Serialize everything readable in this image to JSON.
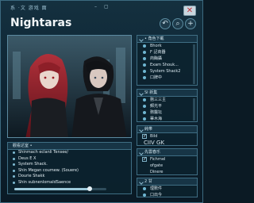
{
  "window": {
    "title_text": "系 ·文  游戏  面",
    "minimize_glyph": "–",
    "restore_glyph": "▢",
    "close_glyph": "✕"
  },
  "app": {
    "title": "Nightaras",
    "buttons": [
      {
        "icon": "back-arrow-icon",
        "glyph": "↶"
      },
      {
        "icon": "search-icon",
        "glyph": "⌕"
      },
      {
        "icon": "plus-icon",
        "glyph": "+"
      }
    ]
  },
  "panels": {
    "characters": {
      "header": "• 角色下載",
      "items": [
        "Bhork",
        "F 記商器",
        "商酶攝",
        "Exam Shouk...",
        "System Shack2",
        "口牌中"
      ]
    },
    "info": {
      "header": "SI 新集",
      "items": [
        "務三三主",
        "郵光平",
        "務醫坛",
        "畢木海"
      ]
    },
    "options": {
      "header": "純帯",
      "items": [
        {
          "label": "Bild",
          "checked": true
        },
        {
          "label": "CIIV GK",
          "checked": false
        }
      ]
    },
    "music": {
      "header": "先雲春乐",
      "items": [
        "Fichrnel",
        "ofgate",
        "Dinere"
      ]
    },
    "tools": {
      "header": "2 甘",
      "items": [
        "理數件",
        "口出今"
      ]
    }
  },
  "playlist": {
    "header": "觀看达室 •",
    "items": [
      "Shinmach eclanli Tensee/",
      "Deus E X",
      "System Shack.",
      "Shin Megan coumew. (Souere)",
      "Dourie Shakk",
      "Shin subnenlomaldSaence"
    ],
    "progress_fraction": 0.82
  },
  "colors": {
    "accent": "#6fb6d2",
    "close_red": "#c2333a",
    "panel_bg": "#0c222e"
  }
}
